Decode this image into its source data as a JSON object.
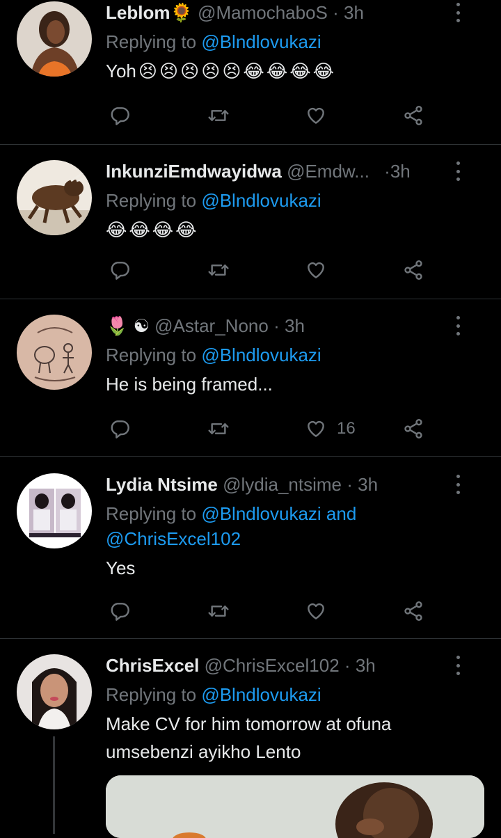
{
  "tweets": [
    {
      "name": "Leblom",
      "name_emoji": "🌻",
      "handle": "@MamochaboS",
      "dot": "·",
      "time": "3h",
      "reply_prefix": "Replying to",
      "mentions": [
        "@Blndlovukazi"
      ],
      "text": "Yoh",
      "emojis": [
        "😣",
        "😣",
        "😣",
        "😣",
        "😣",
        "😂",
        "😂",
        "😂",
        "😂"
      ]
    },
    {
      "name": "InkunziEmdwayidwa",
      "handle": "@Emdw...",
      "dot": "·",
      "time": "3h",
      "reply_prefix": "Replying to",
      "mentions": [
        "@Blndlovukazi"
      ],
      "text": "",
      "emojis": [
        "😂",
        "😂",
        "😂",
        "😂"
      ]
    },
    {
      "name_emojis": "🌷 ☯",
      "handle": "@Astar_Nono",
      "dot": "·",
      "time": "3h",
      "reply_prefix": "Replying to",
      "mentions": [
        "@Blndlovukazi"
      ],
      "text": "He is being framed...",
      "like_count": "16"
    },
    {
      "name": "Lydia Ntsime",
      "handle": "@lydia_ntsime",
      "dot": "·",
      "time": "3h",
      "reply_prefix": "Replying to",
      "mentions": [
        "@Blndlovukazi",
        "and",
        "@ChrisExcel102"
      ],
      "text": "Yes"
    },
    {
      "name": "ChrisExcel",
      "handle": "@ChrisExcel102",
      "dot": "·",
      "time": "3h",
      "reply_prefix": "Replying to",
      "mentions": [
        "@Blndlovukazi"
      ],
      "text_line1": "Make CV for him tomorrow at ofuna",
      "text_line2": "umsebenzi ayikho Lento"
    }
  ],
  "icons": {
    "reply": "reply-icon",
    "retweet": "retweet-icon",
    "like": "like-icon",
    "share": "share-icon",
    "more": "more-icon"
  },
  "colors": {
    "background": "#000000",
    "text": "#e7e9ea",
    "muted": "#71767b",
    "link": "#1d9bf0",
    "divider": "#2f3336"
  }
}
